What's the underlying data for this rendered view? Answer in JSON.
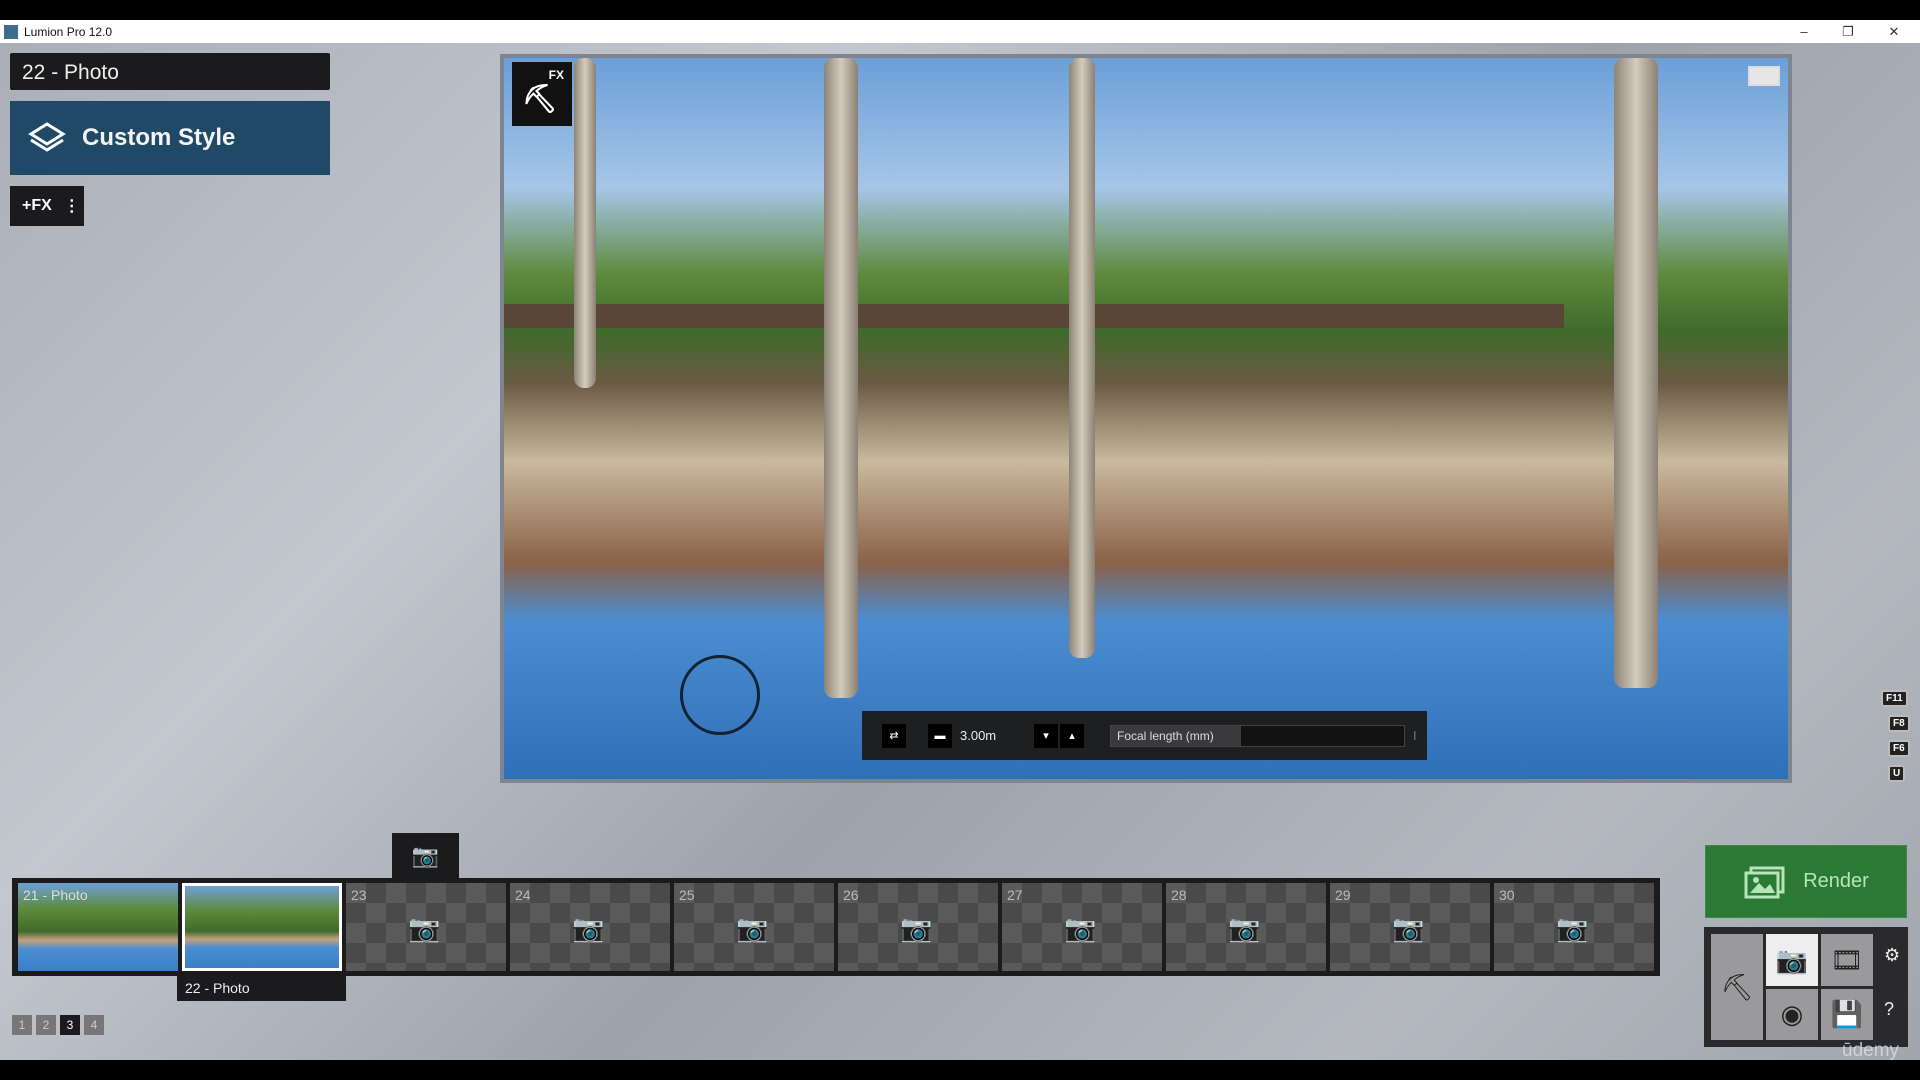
{
  "window": {
    "title": "Lumion Pro 12.0",
    "minimize": "–",
    "restore": "❐",
    "close": "✕"
  },
  "left": {
    "photo_name": "22 - Photo",
    "style_label": "Custom Style",
    "fx_label": "+FX",
    "more": "⋮"
  },
  "viewport": {
    "fx_badge": "FX"
  },
  "camera_toolbar": {
    "distance": "3.00m",
    "focal_label": "Focal length (mm)",
    "focal_value": ""
  },
  "fkeys": [
    "F11",
    "F8",
    "F6",
    "U"
  ],
  "filmstrip": {
    "slots": [
      {
        "label": "21 - Photo",
        "filled": true
      },
      {
        "label": "",
        "filled": true,
        "selected": true
      },
      {
        "label": "23"
      },
      {
        "label": "24"
      },
      {
        "label": "25"
      },
      {
        "label": "26"
      },
      {
        "label": "27"
      },
      {
        "label": "28"
      },
      {
        "label": "29"
      },
      {
        "label": "30"
      }
    ],
    "selected_label": "22 - Photo"
  },
  "pages": [
    "1",
    "2",
    "3",
    "4"
  ],
  "active_page": "3",
  "render": {
    "label": "Render",
    "color": "#2a7a35"
  },
  "watermark": "ūdemy"
}
